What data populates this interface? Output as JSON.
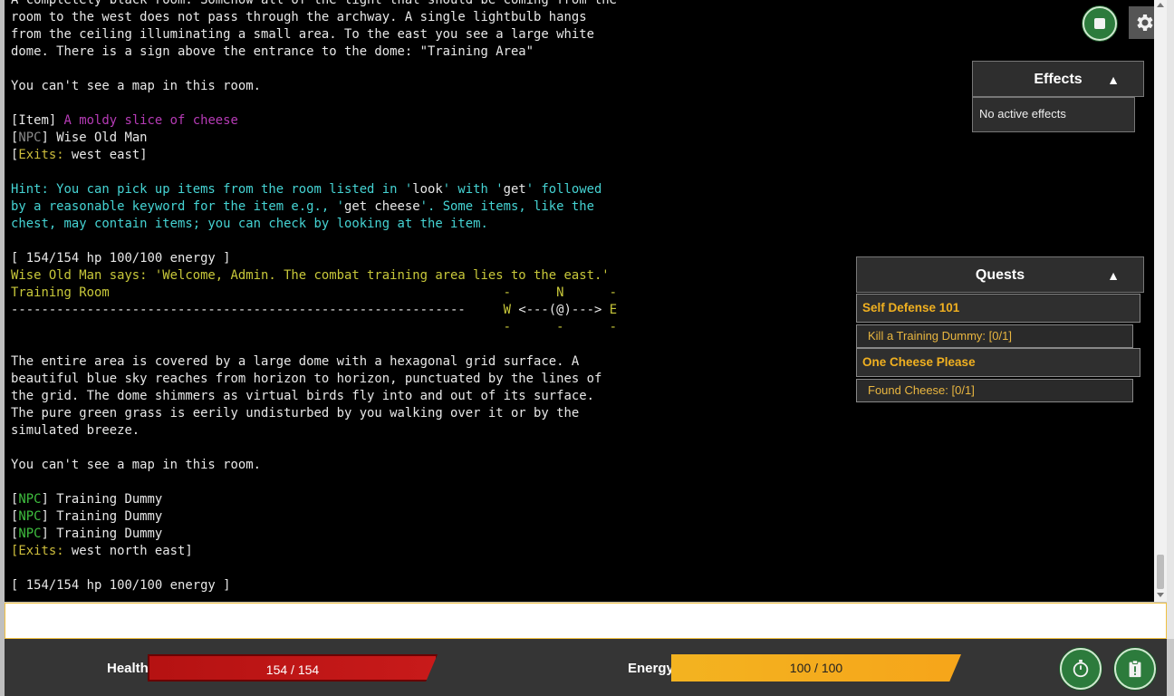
{
  "log": [
    {
      "parts": [
        {
          "t": "A completely black room. Somehow all of the light that should be coming from the",
          "c": "wht"
        }
      ]
    },
    {
      "parts": [
        {
          "t": "room to the west does not pass through the archway. A single lightbulb hangs",
          "c": "wht"
        }
      ]
    },
    {
      "parts": [
        {
          "t": "from the ceiling illuminating a small area. To the east you see a large white",
          "c": "wht"
        }
      ]
    },
    {
      "parts": [
        {
          "t": "dome. There is a sign above the entrance to the dome: \"Training Area\"",
          "c": "wht"
        }
      ]
    },
    {
      "parts": [
        {
          "t": "",
          "c": "wht"
        }
      ]
    },
    {
      "parts": [
        {
          "t": "You can't see a map in this room.",
          "c": "wht"
        }
      ]
    },
    {
      "parts": [
        {
          "t": "",
          "c": "wht"
        }
      ]
    },
    {
      "parts": [
        {
          "t": "[Item] ",
          "c": "wht"
        },
        {
          "t": "A moldy slice of cheese",
          "c": "mag"
        }
      ]
    },
    {
      "parts": [
        {
          "t": "[",
          "c": "wht"
        },
        {
          "t": "NPC",
          "c": "gry"
        },
        {
          "t": "] Wise Old Man",
          "c": "wht"
        }
      ]
    },
    {
      "parts": [
        {
          "t": "[",
          "c": "wht"
        },
        {
          "t": "Exits:",
          "c": "ylw"
        },
        {
          "t": " west east]",
          "c": "wht"
        }
      ]
    },
    {
      "parts": [
        {
          "t": "",
          "c": "wht"
        }
      ]
    },
    {
      "parts": [
        {
          "t": "Hint: You can pick up items from the room listed in '",
          "c": "cyn"
        },
        {
          "t": "look",
          "c": "wht"
        },
        {
          "t": "' with '",
          "c": "cyn"
        },
        {
          "t": "get",
          "c": "wht"
        },
        {
          "t": "' followed",
          "c": "cyn"
        }
      ]
    },
    {
      "parts": [
        {
          "t": "by a reasonable keyword for the item e.g., '",
          "c": "cyn"
        },
        {
          "t": "get cheese",
          "c": "wht"
        },
        {
          "t": "'. Some items, like the",
          "c": "cyn"
        }
      ]
    },
    {
      "parts": [
        {
          "t": "chest, may contain items; you can check by looking at the item.",
          "c": "cyn"
        }
      ]
    },
    {
      "parts": [
        {
          "t": "",
          "c": "wht"
        }
      ]
    },
    {
      "parts": [
        {
          "t": "[ 154/154 hp 100/100 energy ]",
          "c": "wht"
        }
      ]
    },
    {
      "parts": [
        {
          "t": "Wise Old Man says: 'Welcome, Admin. The combat training area lies to the east.'",
          "c": "yel"
        }
      ]
    },
    {
      "parts": [
        {
          "t": "Training Room                                                    -      N      -",
          "c": "yel"
        }
      ]
    },
    {
      "parts": [
        {
          "t": "------------------------------------------------------------     ",
          "c": "wht"
        },
        {
          "t": "W",
          "c": "yel"
        },
        {
          "t": " <---(@)---> ",
          "c": "wht"
        },
        {
          "t": "E",
          "c": "yel"
        }
      ]
    },
    {
      "parts": [
        {
          "t": "                                                                 -      -      -",
          "c": "yel"
        }
      ]
    },
    {
      "parts": [
        {
          "t": "",
          "c": "wht"
        }
      ]
    },
    {
      "parts": [
        {
          "t": "The entire area is covered by a large dome with a hexagonal grid surface. A",
          "c": "wht"
        }
      ]
    },
    {
      "parts": [
        {
          "t": "beautiful blue sky reaches from horizon to horizon, punctuated by the lines of",
          "c": "wht"
        }
      ]
    },
    {
      "parts": [
        {
          "t": "the grid. The dome shimmers as virtual birds fly into and out of its surface.",
          "c": "wht"
        }
      ]
    },
    {
      "parts": [
        {
          "t": "The pure green grass is eerily undisturbed by you walking over it or by the",
          "c": "wht"
        }
      ]
    },
    {
      "parts": [
        {
          "t": "simulated breeze.",
          "c": "wht"
        }
      ]
    },
    {
      "parts": [
        {
          "t": "",
          "c": "wht"
        }
      ]
    },
    {
      "parts": [
        {
          "t": "You can't see a map in this room.",
          "c": "wht"
        }
      ]
    },
    {
      "parts": [
        {
          "t": "",
          "c": "wht"
        }
      ]
    },
    {
      "parts": [
        {
          "t": "[",
          "c": "wht"
        },
        {
          "t": "NPC",
          "c": "grn"
        },
        {
          "t": "] Training Dummy",
          "c": "wht"
        }
      ]
    },
    {
      "parts": [
        {
          "t": "[",
          "c": "wht"
        },
        {
          "t": "NPC",
          "c": "grn"
        },
        {
          "t": "] Training Dummy",
          "c": "wht"
        }
      ]
    },
    {
      "parts": [
        {
          "t": "[",
          "c": "wht"
        },
        {
          "t": "NPC",
          "c": "grn"
        },
        {
          "t": "] Training Dummy",
          "c": "wht"
        }
      ]
    },
    {
      "parts": [
        {
          "t": "[",
          "c": "ylw"
        },
        {
          "t": "Exits:",
          "c": "ylw"
        },
        {
          "t": " west north east]",
          "c": "wht"
        }
      ]
    },
    {
      "parts": [
        {
          "t": "",
          "c": "wht"
        }
      ]
    },
    {
      "parts": [
        {
          "t": "[ 154/154 hp 100/100 energy ]",
          "c": "wht"
        }
      ]
    }
  ],
  "effects": {
    "title": "Effects",
    "toggle": "▲",
    "empty": "No active effects"
  },
  "quests": {
    "title": "Quests",
    "toggle": "▲",
    "items": [
      {
        "name": "Self Defense 101",
        "objective": "Kill a Training Dummy: [0/1]"
      },
      {
        "name": "One Cheese Please",
        "objective": "Found Cheese: [0/1]"
      }
    ]
  },
  "input": {
    "value": "",
    "placeholder": ""
  },
  "status": {
    "health_label": "Health",
    "health_text": "154  /  154",
    "health_fraction": 1.0,
    "energy_label": "Energy",
    "energy_text": "100  /  100",
    "energy_fraction": 1.0
  },
  "colors": {
    "accent_green": "#2c7b3c",
    "health": "#c81a1a",
    "energy": "#f6a51a",
    "quest": "#f0b020"
  },
  "icons": {
    "stop": "stop-icon",
    "settings": "gear-icon",
    "timer": "stopwatch-icon",
    "clipboard": "clipboard-icon"
  }
}
